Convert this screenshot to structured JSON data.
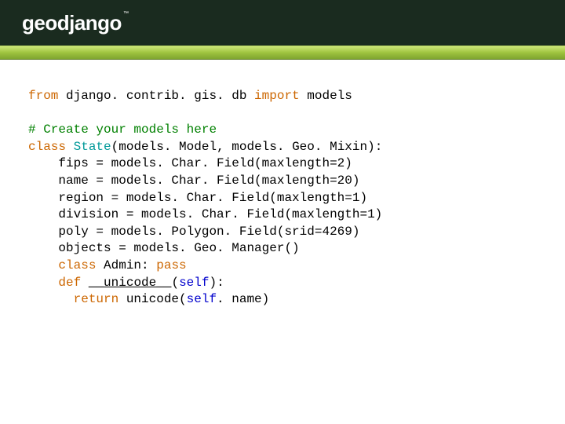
{
  "header": {
    "logo_text": "geodjango",
    "tm": "™"
  },
  "code": {
    "l1_from": "from",
    "l1_mod": " django. contrib. gis. db ",
    "l1_import": "import",
    "l1_models": " models",
    "blank": "",
    "l3_comment": "# Create your models here",
    "l4_class": "class",
    "l4_sp": " ",
    "l4_name": "State",
    "l4_rest": "(models. Model, models. Geo. Mixin):",
    "l5": "    fips = models. Char. Field(maxlength=2)",
    "l6": "    name = models. Char. Field(maxlength=20)",
    "l7": "    region = models. Char. Field(maxlength=1)",
    "l8": "    division = models. Char. Field(maxlength=1)",
    "l9": "    poly = models. Polygon. Field(srid=4269)",
    "l10": "    objects = models. Geo. Manager()",
    "l11_indent": "    ",
    "l11_class": "class",
    "l11_rest": " Admin: ",
    "l11_pass": "pass",
    "l12_indent": "    ",
    "l12_def": "def",
    "l12_sp": " ",
    "l12_name": "__unicode__",
    "l12_open": "(",
    "l12_self": "self",
    "l12_close": "):",
    "l13_indent": "      ",
    "l13_return": "return",
    "l13_unicode": " unicode(",
    "l13_self": "self",
    "l13_rest": ". name)"
  }
}
